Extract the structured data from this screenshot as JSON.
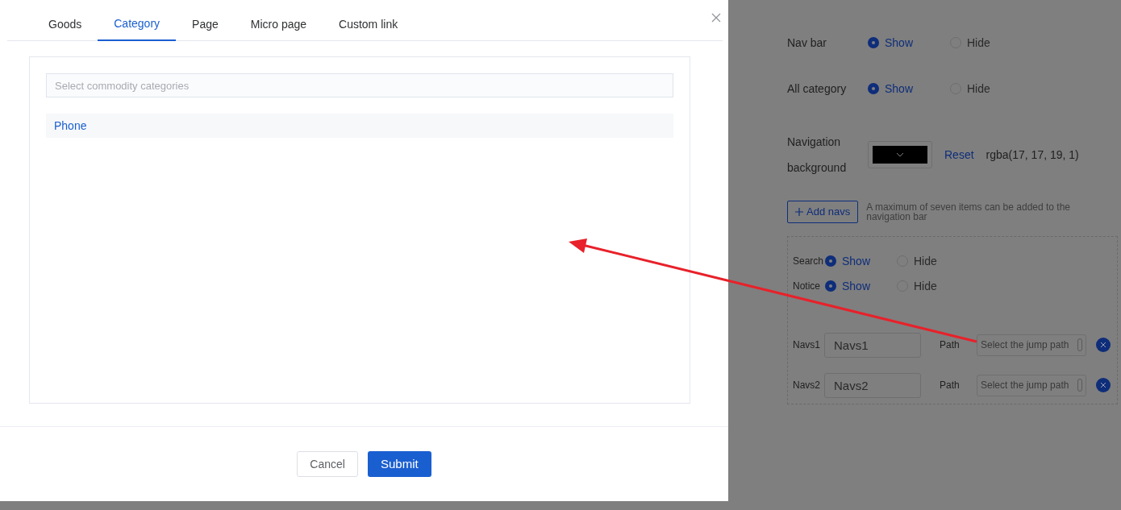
{
  "dialog": {
    "tabs": [
      {
        "label": "Goods",
        "selected": false
      },
      {
        "label": "Category",
        "selected": true
      },
      {
        "label": "Page",
        "selected": false
      },
      {
        "label": "Micro page",
        "selected": false
      },
      {
        "label": "Custom link",
        "selected": false
      }
    ],
    "search": {
      "placeholder": "Select commodity categories"
    },
    "categories": [
      {
        "label": "Phone",
        "selected": true
      }
    ],
    "buttons": [
      {
        "label": "Cancel",
        "kind": "secondary"
      },
      {
        "label": "Submit",
        "kind": "primary"
      }
    ]
  },
  "settings": {
    "rows": [
      {
        "label": "Nav bar",
        "options": [
          {
            "label": "Show",
            "selected": true
          },
          {
            "label": "Hide",
            "selected": false
          }
        ]
      },
      {
        "label": "All category",
        "options": [
          {
            "label": "Show",
            "selected": true
          },
          {
            "label": "Hide",
            "selected": false
          }
        ]
      }
    ],
    "nav_background": {
      "label": "Navigation background",
      "reset": "Reset",
      "value": "rgba(17, 17, 19, 1)"
    },
    "add_button": "Add navs",
    "add_hint": "A maximum of seven items can be added to the navigation bar",
    "nav_panel": {
      "toggles": [
        {
          "label": "Search",
          "options": [
            {
              "label": "Show",
              "selected": true
            },
            {
              "label": "Hide",
              "selected": false
            }
          ]
        },
        {
          "label": "Notice",
          "options": [
            {
              "label": "Show",
              "selected": true
            },
            {
              "label": "Hide",
              "selected": false
            }
          ]
        }
      ],
      "navs": [
        {
          "label": "Navs1",
          "value": "Navs1",
          "path_label": "Path",
          "path_placeholder": "Select the jump path"
        },
        {
          "label": "Navs2",
          "value": "Navs2",
          "path_label": "Path",
          "path_placeholder": "Select the jump path"
        }
      ]
    }
  }
}
